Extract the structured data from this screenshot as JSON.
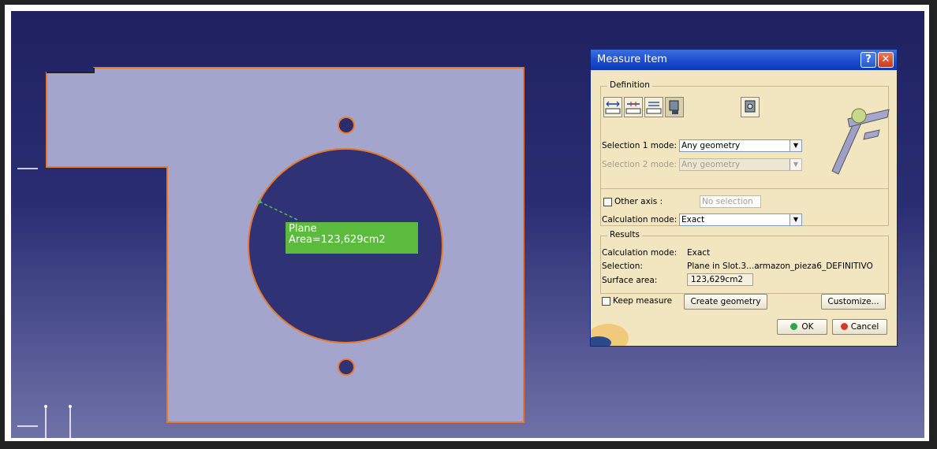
{
  "viewport": {
    "annotation": {
      "line1": "Plane",
      "line2": "Area=123,629cm2"
    }
  },
  "dialog": {
    "title": "Measure Item",
    "help_button": "?",
    "close_button": "✕",
    "definition": {
      "legend": "Definition",
      "tool_icons": [
        "measure-between-icon",
        "measure-between-chain-icon",
        "measure-between-fan-icon",
        "measure-item-icon",
        "measure-thickness-icon"
      ],
      "selection1_label": "Selection 1 mode:",
      "selection1_value": "Any geometry",
      "selection2_label": "Selection 2 mode:",
      "selection2_value": "Any geometry",
      "other_axis_label": "Other axis :",
      "other_axis_value": "No selection",
      "calc_mode_label": "Calculation mode:",
      "calc_mode_value": "Exact"
    },
    "results": {
      "legend": "Results",
      "calc_mode_label": "Calculation mode:",
      "calc_mode_value": "Exact",
      "selection_label": "Selection:",
      "selection_value": "Plane in Slot.3...armazon_pieza6_DEFINITIVO",
      "surface_label": "Surface area:",
      "surface_value": "123,629cm2"
    },
    "keep_measure_label": "Keep measure",
    "create_geometry_label": "Create geometry",
    "customize_label": "Customize...",
    "ok_label": "OK",
    "cancel_label": "Cancel"
  },
  "colors": {
    "part_fill": "#a4a5cc",
    "part_edge": "#e8782a",
    "annotation_bg": "#5bbb3c",
    "dialog_bg": "#f2e6c0",
    "titlebar": "#1d4fcf"
  }
}
